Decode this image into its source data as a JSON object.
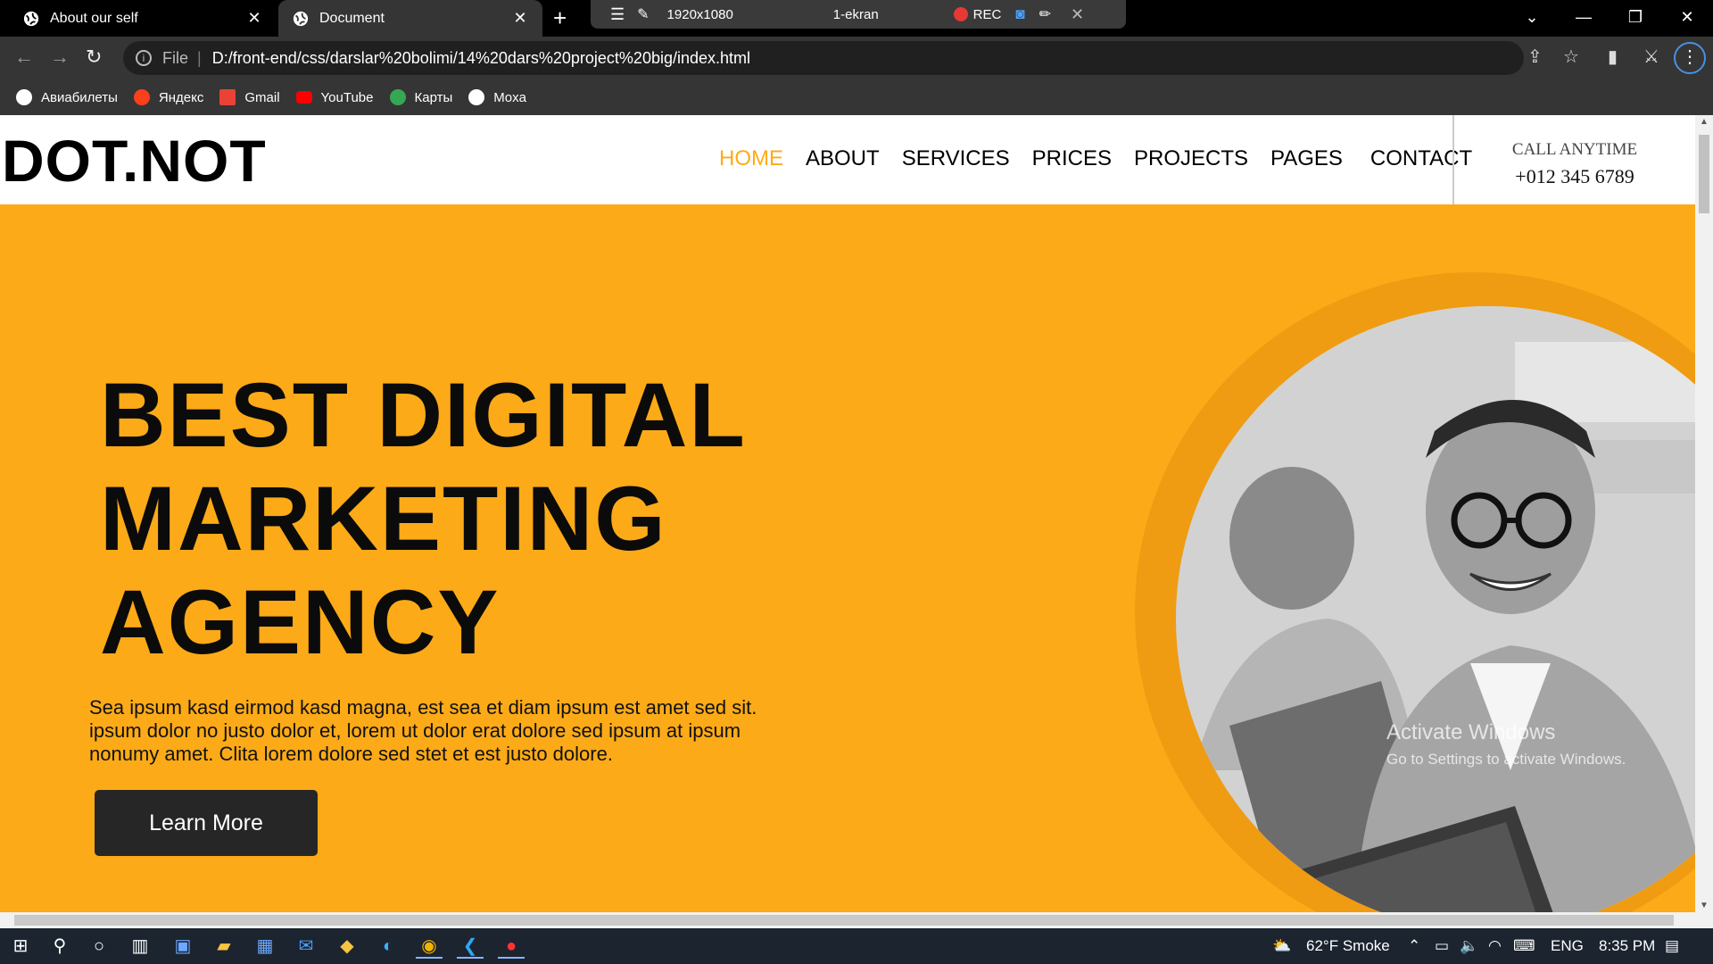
{
  "browser": {
    "tabs": [
      {
        "title": "About our self"
      },
      {
        "title": "Document"
      }
    ],
    "recorder": {
      "resolution": "1920x1080",
      "screen": "1-ekran",
      "rec_label": "REC"
    },
    "address": {
      "scheme": "File",
      "url": "D:/front-end/css/darslar%20bolimi/14%20dars%20project%20big/index.html"
    },
    "bookmarks": [
      {
        "label": "Авиабилеты",
        "color": "#ffffff"
      },
      {
        "label": "Яндекс",
        "color": "#fc3f1d"
      },
      {
        "label": "Gmail",
        "color": "#ea4335"
      },
      {
        "label": "YouTube",
        "color": "#ff0000"
      },
      {
        "label": "Карты",
        "color": "#34a853"
      },
      {
        "label": "Moxa",
        "color": "#ffffff"
      }
    ]
  },
  "site": {
    "logo": "DOT.NOT",
    "nav": [
      "HOME",
      "ABOUT",
      "SERVICES",
      "PRICES",
      "PROJECTS",
      "PAGES",
      "CONTACT"
    ],
    "call_label": "CALL ANYTIME",
    "call_number": "+012 345 6789",
    "hero": {
      "headline_1": "BEST DIGITAL",
      "headline_2": "MARKETING",
      "headline_3": "AGENCY",
      "lead": "Sea ipsum kasd eirmod kasd magna, est sea et diam ipsum est amet sed sit. ipsum dolor no justo dolor et, lorem ut dolor erat dolore sed ipsum at ipsum nonumy amet. Clita lorem dolore sed stet et est justo dolore.",
      "cta": "Learn More"
    },
    "colors": {
      "accent": "#fcaa17",
      "accent_dark": "#ef9c12",
      "button": "#262626"
    }
  },
  "watermark": {
    "line1": "Activate Windows",
    "line2": "Go to Settings to activate Windows."
  },
  "taskbar": {
    "weather": "62°F  Smoke",
    "lang": "ENG",
    "time": "8:35 PM"
  }
}
